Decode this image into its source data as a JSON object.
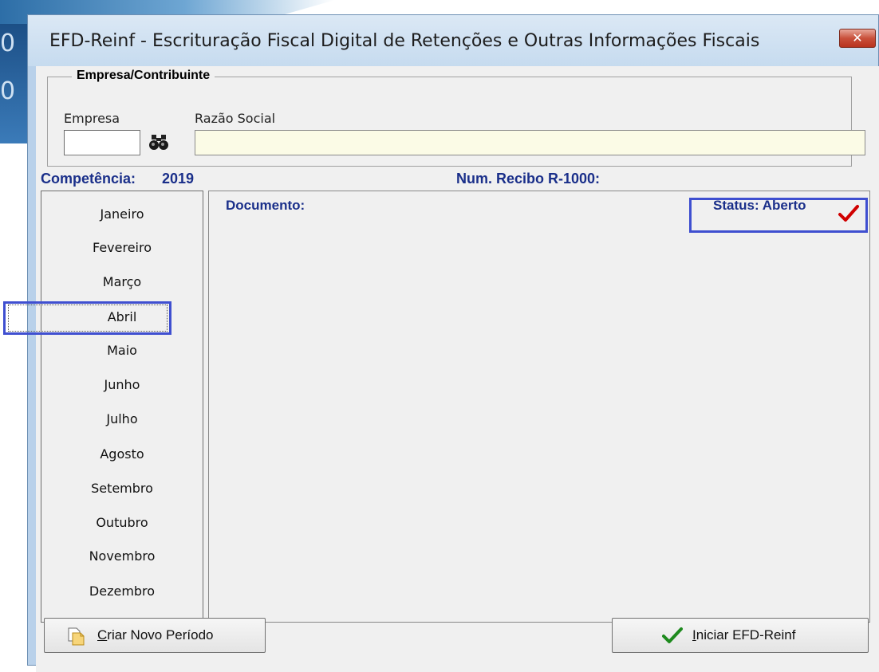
{
  "window": {
    "title": "EFD-Reinf - Escrituração Fiscal Digital de Retenções e Outras Informações Fiscais",
    "close_icon": "close-icon"
  },
  "empresa_group": {
    "legend": "Empresa/Contribuinte",
    "empresa_label": "Empresa",
    "empresa_value": "",
    "razao_label": "Razão Social",
    "razao_value": "",
    "search_icon": "binoculars-icon"
  },
  "competencia": {
    "label": "Competência:",
    "year": "2019"
  },
  "recibo": {
    "label": "Num. Recibo R-1000:",
    "value": ""
  },
  "months": [
    {
      "label": "Janeiro"
    },
    {
      "label": "Fevereiro"
    },
    {
      "label": "Março"
    },
    {
      "label": "Abril",
      "selected": true
    },
    {
      "label": "Maio"
    },
    {
      "label": "Junho"
    },
    {
      "label": "Julho"
    },
    {
      "label": "Agosto"
    },
    {
      "label": "Setembro"
    },
    {
      "label": "Outubro"
    },
    {
      "label": "Novembro"
    },
    {
      "label": "Dezembro"
    }
  ],
  "panel": {
    "documento_label": "Documento:",
    "documento_value": "",
    "status_label": "Status: Aberto",
    "status_icon": "checkmark-icon"
  },
  "buttons": {
    "criar_label": "Criar Novo Período",
    "criar_mnemonic": "C",
    "criar_rest": "riar Novo Período",
    "criar_icon": "new-document-icon",
    "iniciar_label": "Iniciar EFD-Reinf",
    "iniciar_mnemonic": "I",
    "iniciar_rest": "niciar EFD-Reinf",
    "iniciar_icon": "checkmark-icon"
  },
  "colors": {
    "accent_text": "#1a2f8a",
    "highlight_border": "#3f4fd0",
    "status_check": "#d00000",
    "start_check": "#1e8a1e"
  }
}
